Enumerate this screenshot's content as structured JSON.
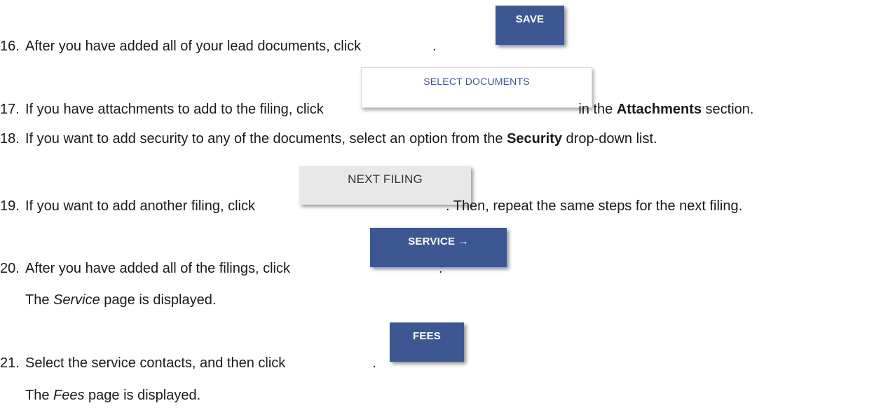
{
  "steps": [
    {
      "number": "16.",
      "text_before": "After you have added all of your lead documents, click",
      "button_label": "SAVE",
      "text_after": "."
    },
    {
      "number": "17.",
      "text_before": "If you have attachments to add to the filing, click",
      "button_label": "SELECT DOCUMENTS",
      "text_after_1": " in the ",
      "text_after_bold": "Attachments",
      "text_after_2": " section."
    },
    {
      "number": "18.",
      "text_before": "If you want to add security to any of the documents, select an option from the ",
      "text_bold": "Security",
      "text_after": " drop-down list."
    },
    {
      "number": "19.",
      "text_before": "If you want to add another filing, click",
      "button_label": "NEXT FILING",
      "text_after": ". Then, repeat the same steps for the next filing."
    },
    {
      "number": "20.",
      "text_before": "After you have added all of the filings, click",
      "button_label": "SERVICE →",
      "text_after": "."
    },
    {
      "number": "21.",
      "text_before": "Select the service contacts, and then click",
      "button_label": "FEES",
      "text_after": "."
    }
  ],
  "notes": {
    "service": {
      "before": "The ",
      "italic": "Service",
      "after": " page is displayed."
    },
    "fees": {
      "before": "The ",
      "italic": "Fees",
      "after": " page is displayed."
    }
  },
  "colors": {
    "primary_button": "#3d5793",
    "outline_button_text": "#3d5793",
    "grey_button": "#e8e8e8"
  }
}
